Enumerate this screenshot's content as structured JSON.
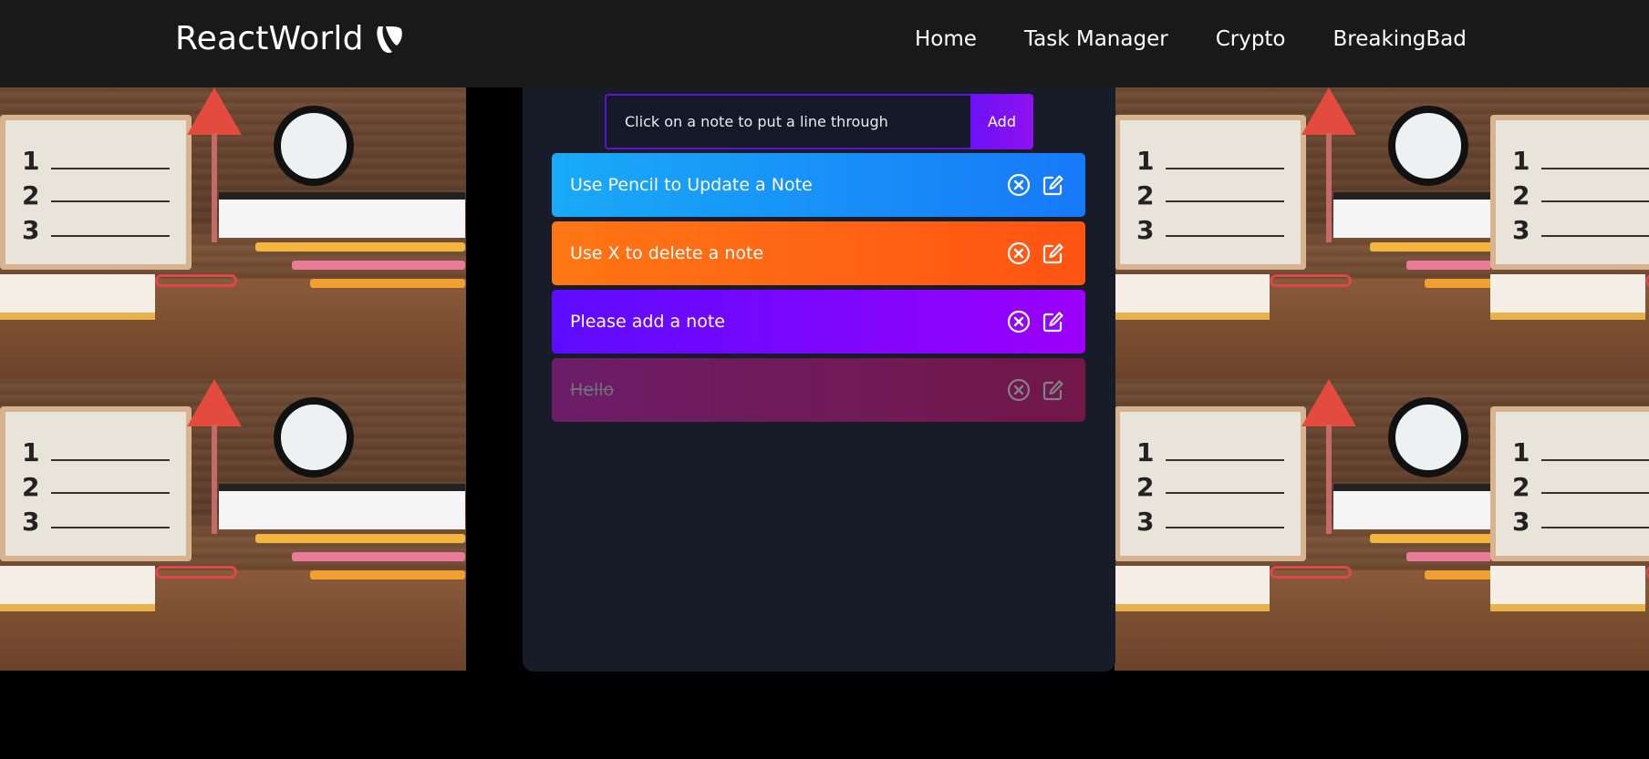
{
  "navbar": {
    "brand": "ReactWorld",
    "brand_icon": "typo3-logo-icon",
    "links": [
      {
        "label": "Home"
      },
      {
        "label": "Task Manager"
      },
      {
        "label": "Crypto"
      },
      {
        "label": "BreakingBad"
      }
    ]
  },
  "form": {
    "placeholder": "Click on a note to put a line through",
    "value": "",
    "add_label": "Add"
  },
  "todos": [
    {
      "text": "Use Pencil to Update a Note",
      "completed": false,
      "delete_icon": "circle-x-icon",
      "edit_icon": "pencil-square-icon"
    },
    {
      "text": "Use X to delete a note",
      "completed": false,
      "delete_icon": "circle-x-icon",
      "edit_icon": "pencil-square-icon"
    },
    {
      "text": "Please add a note",
      "completed": false,
      "delete_icon": "circle-x-icon",
      "edit_icon": "pencil-square-icon"
    },
    {
      "text": "Hello",
      "completed": true,
      "delete_icon": "circle-x-icon",
      "edit_icon": "pencil-square-icon"
    }
  ],
  "colors": {
    "navbar_bg": "#1a1919",
    "panel_bg": "#181c28",
    "accent_purple": "#5b13d4",
    "todo_blue": "#1779f8",
    "todo_orange": "#ff5413",
    "todo_violet": "#9b00fa",
    "todo_pink": "#e0116f"
  }
}
